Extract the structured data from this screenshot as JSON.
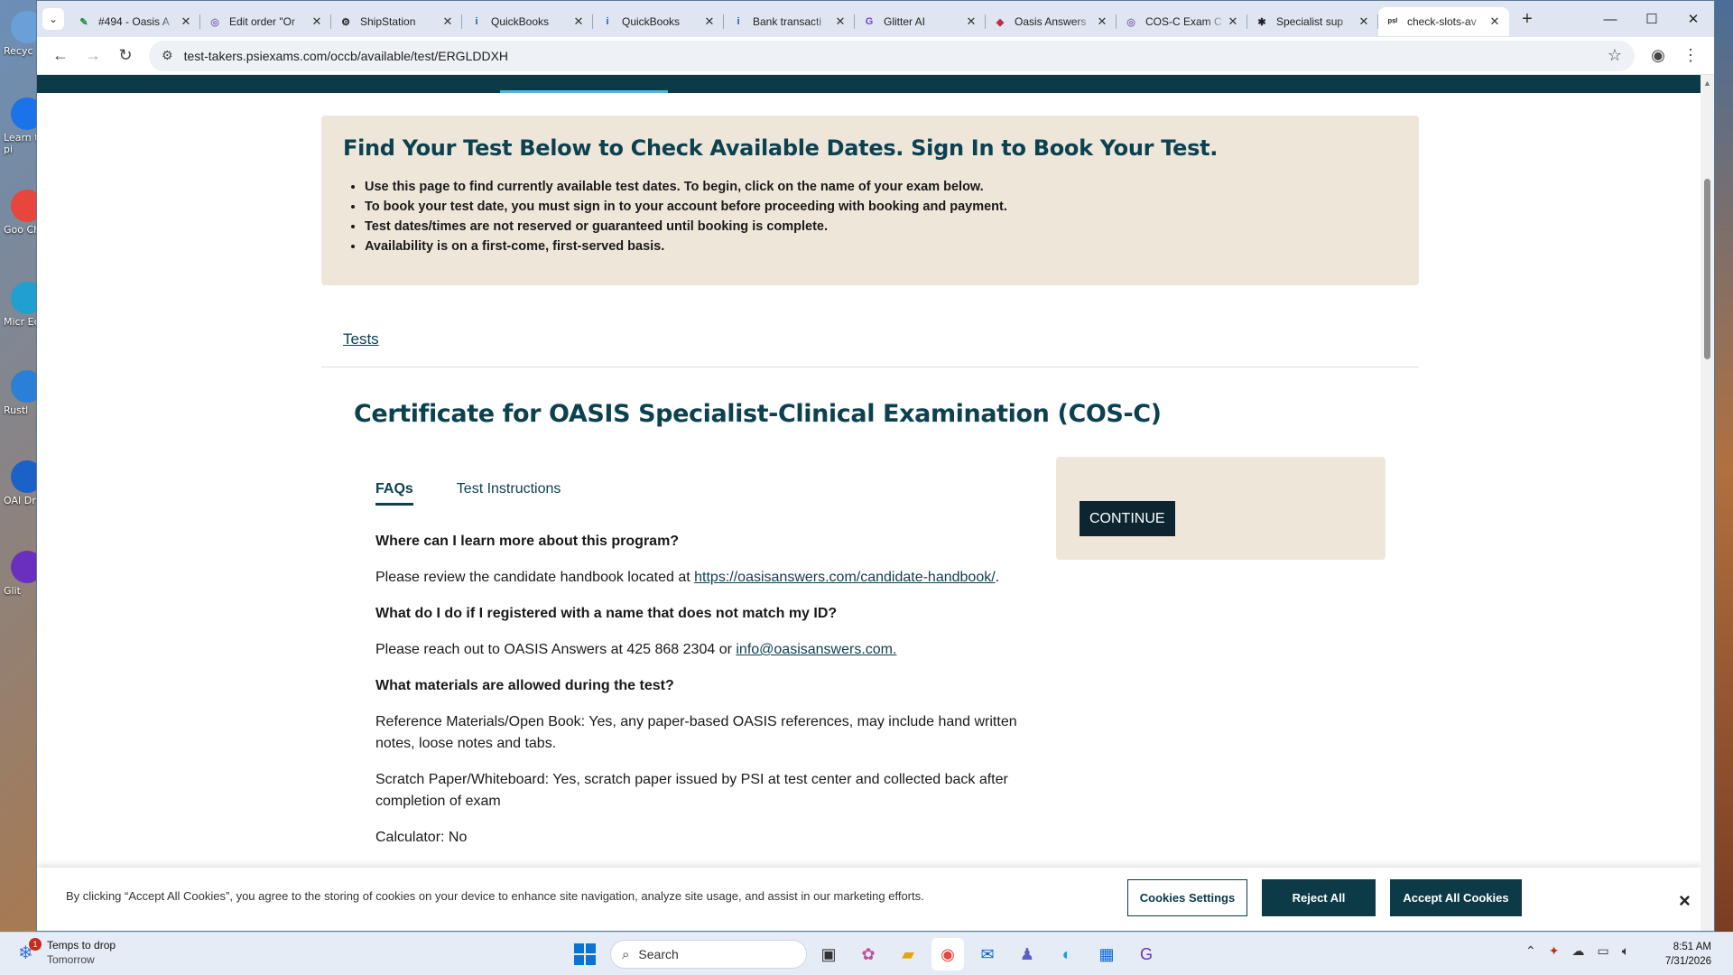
{
  "browser": {
    "tabs": [
      {
        "title": "#494 - Oasis A",
        "icon": "edit-icon",
        "color": "#1e8e3e",
        "glyph": "✎"
      },
      {
        "title": "Edit order \"Or",
        "icon": "loop-icon",
        "color": "#8c6bb1",
        "glyph": "◎"
      },
      {
        "title": "ShipStation",
        "icon": "gear-icon",
        "color": "#222222",
        "glyph": "⚙"
      },
      {
        "title": "QuickBooks",
        "icon": "info-icon",
        "color": "#0a5ad6",
        "glyph": "i"
      },
      {
        "title": "QuickBooks",
        "icon": "info-icon",
        "color": "#0a5ad6",
        "glyph": "i"
      },
      {
        "title": "Bank transacti",
        "icon": "info-icon",
        "color": "#0a5ad6",
        "glyph": "i"
      },
      {
        "title": "Glitter AI",
        "icon": "glitter-icon",
        "color": "#7b3fd0",
        "glyph": "G"
      },
      {
        "title": "Oasis Answers",
        "icon": "shield-icon",
        "color": "#c42b4a",
        "glyph": "◆"
      },
      {
        "title": "COS-C Exam C",
        "icon": "loop-icon",
        "color": "#8c6bb1",
        "glyph": "◎"
      },
      {
        "title": "Specialist sup",
        "icon": "asterisk-icon",
        "color": "#222222",
        "glyph": "✱"
      },
      {
        "title": "check-slots-av",
        "icon": "psi-icon",
        "color": "#222222",
        "glyph": "ᵖˢⁱ",
        "active": true
      }
    ],
    "url": "test-takers.psiexams.com/occb/available/test/ERGLDDXH"
  },
  "banner": {
    "heading": "Find Your Test Below to Check Available Dates. Sign In to Book Your Test.",
    "bullets": [
      "Use this page to find currently available test dates. To begin, click on the name of your exam below.",
      "To book your test date, you must sign in to your account before proceeding with booking and payment.",
      "Test dates/times are not reserved or guaranteed until booking is complete.",
      "Availability is on a first-come, first-served basis."
    ]
  },
  "breadcrumb": {
    "tests": "Tests"
  },
  "exam": {
    "title": "Certificate for OASIS Specialist-Clinical Examination (COS-C)",
    "tabs": {
      "faqs": "FAQs",
      "instructions": "Test Instructions"
    },
    "continue_label": "CONTINUE"
  },
  "faq": {
    "q1": "Where can I learn more about this program?",
    "a1_pre": "Please review the candidate handbook located at ",
    "a1_link": "https://oasisanswers.com/candidate-handbook/",
    "a1_post": ".",
    "q2": "What do I do if I registered with a name that does not match my ID?",
    "a2_pre": "Please reach out to OASIS Answers at 425 868 2304 or ",
    "a2_link": "info@oasisanswers.com.",
    "q3": "What materials are allowed during the test?",
    "a3": "Reference Materials/Open Book: Yes, any paper-based OASIS references, may include hand written notes, loose notes and tabs.",
    "a4": "Scratch Paper/Whiteboard: Yes, scratch paper issued by PSI at test center and collected back after completion of exam",
    "a5": "Calculator: No"
  },
  "cookie": {
    "text": "By clicking “Accept All Cookies”, you agree to the storing of cookies on your device to enhance site navigation, analyze site usage, and assist in our marketing efforts.",
    "settings": "Cookies Settings",
    "reject": "Reject All",
    "accept": "Accept All Cookies",
    "close": "×"
  },
  "desktop_icons": [
    {
      "label": "Recyc",
      "color": "#6aa0d8"
    },
    {
      "label": "Learn this pi",
      "color": "#1a73e8"
    },
    {
      "label": "Goo Chro",
      "color": "#e8453c"
    },
    {
      "label": "Micr Edg",
      "color": "#1fa0d0"
    },
    {
      "label": "Rustl",
      "color": "#2a7fd6"
    },
    {
      "label": "OAI Dr",
      "color": "#1a62c8"
    },
    {
      "label": "Glit",
      "color": "#6b2fc0"
    }
  ],
  "taskbar": {
    "weather_title": "Temps to drop",
    "weather_sub": "Tomorrow",
    "notification_count": "1",
    "search_placeholder": "Search",
    "time": "8:51 AM",
    "date": "7/31/2026"
  }
}
